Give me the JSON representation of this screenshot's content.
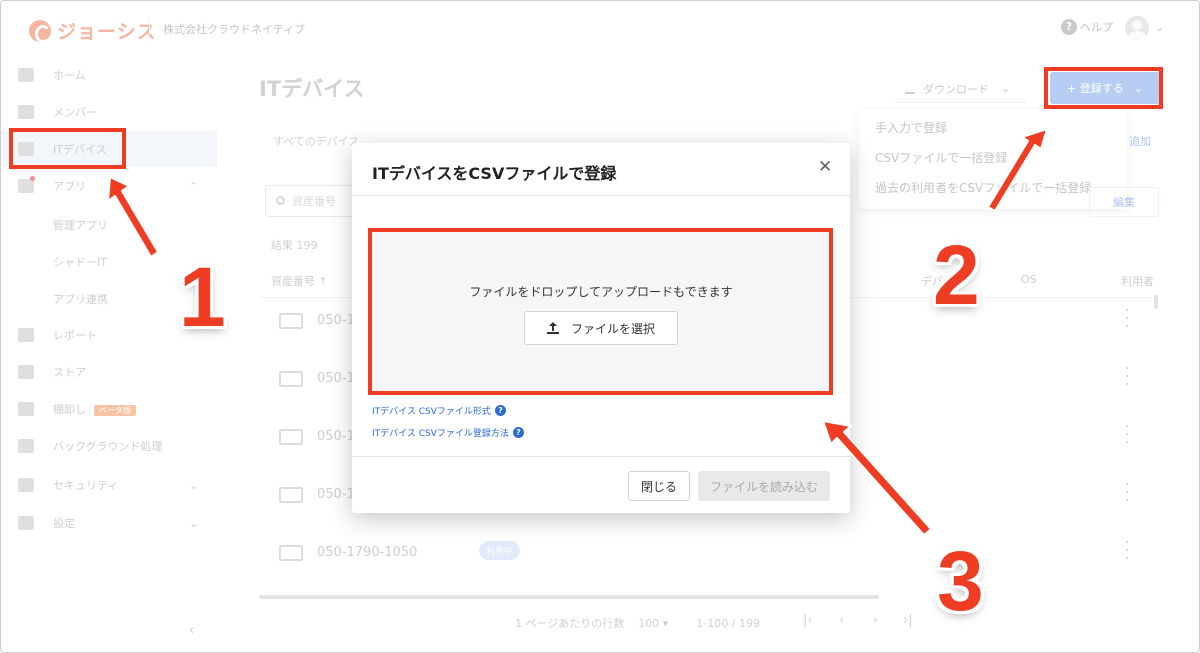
{
  "header": {
    "logo_text": "ジョーシス",
    "company": "株式会社クラウドネイティブ",
    "help_label": "ヘルプ",
    "help_icon": "question-circle-icon",
    "avatar_icon": "user-avatar-icon",
    "chevron": "⌄"
  },
  "sidebar": {
    "items": [
      {
        "label": "ホーム",
        "icon": "home-icon"
      },
      {
        "label": "メンバー",
        "icon": "people-icon"
      },
      {
        "label": "ITデバイス",
        "icon": "laptop-icon"
      },
      {
        "label": "アプリ",
        "icon": "apps-grid-icon"
      },
      {
        "label": "レポート",
        "icon": "report-icon"
      },
      {
        "label": "ストア",
        "icon": "store-icon"
      },
      {
        "label": "棚卸し",
        "icon": "list-icon",
        "badge": "ベータ版"
      },
      {
        "label": "バックグラウンド処理",
        "icon": "calendar-icon"
      },
      {
        "label": "セキュリティ",
        "icon": "shield-icon"
      },
      {
        "label": "設定",
        "icon": "gear-icon"
      }
    ],
    "sub_items": [
      "管理アプリ",
      "シャドーIT",
      "アプリ連携"
    ],
    "expand_up": "⌃",
    "expand_down": "⌄",
    "collapse": "‹"
  },
  "main": {
    "title": "ITデバイス",
    "download_label": "ダウンロード",
    "register_label": "+ 登録する",
    "register_menu": [
      "手入力で登録",
      "CSVファイルで一括登録",
      "過去の利用者をCSVファイルで一括登録"
    ],
    "tab_all": "すべてのデバイス",
    "tab_right": "追加",
    "search_placeholder": "資産番号",
    "filter_right": "編集",
    "result_count": "結果 199",
    "columns": {
      "asset": "資産番号 ↑",
      "device": "デバ",
      "os": "OS",
      "user": "利用者"
    },
    "rows": [
      {
        "asset": "050-1"
      },
      {
        "asset": "050-1"
      },
      {
        "asset": "050-1"
      },
      {
        "asset": "050-1"
      },
      {
        "asset": "050-1790-1050",
        "status": "利用中"
      }
    ],
    "pagination": {
      "rows_per_page_label": "1 ページあたりの行数",
      "rows_per_page": "100 ▾",
      "range": "1-100 / 199",
      "nav": [
        "|‹",
        "‹",
        "›",
        "›|"
      ]
    }
  },
  "modal": {
    "title": "ITデバイスをCSVファイルで登録",
    "close": "✕",
    "drop_text": "ファイルをドロップしてアップロードもできます",
    "select_button": "ファイルを選択",
    "links": [
      "ITデバイス CSVファイル形式",
      "ITデバイス CSVファイル登録方法"
    ],
    "cancel_button": "閉じる",
    "submit_button": "ファイルを読み込む"
  },
  "annotations": {
    "steps": [
      "1",
      "2",
      "3"
    ],
    "color": "#ef3d23"
  }
}
